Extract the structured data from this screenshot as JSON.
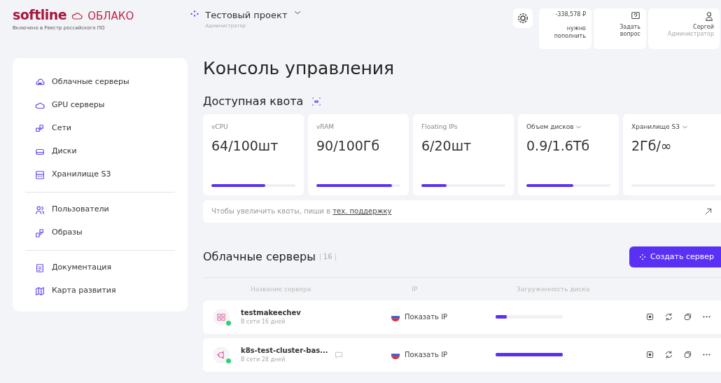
{
  "brand": {
    "name": "softline",
    "product": "ОБЛАКО",
    "tagline": "Включено в Реестр российского ПО"
  },
  "project": {
    "name": "Тестовый проект",
    "role": "Администратор"
  },
  "balance": {
    "amount": "-338,578 ₽",
    "note": "нужно пополнить"
  },
  "help": {
    "label": "Задать вопрос"
  },
  "user": {
    "name": "Сергей",
    "role": "Администратор"
  },
  "sidebar": {
    "groups": [
      {
        "items": [
          {
            "label": "Облачные серверы",
            "kind": "server"
          },
          {
            "label": "GPU серверы",
            "kind": "cloud"
          },
          {
            "label": "Сети",
            "kind": "network"
          },
          {
            "label": "Диски",
            "kind": "disk"
          },
          {
            "label": "Хранилище S3",
            "kind": "storage"
          }
        ]
      },
      {
        "items": [
          {
            "label": "Пользователи",
            "kind": "users"
          },
          {
            "label": "Образы",
            "kind": "images"
          }
        ]
      },
      {
        "items": [
          {
            "label": "Документация",
            "kind": "doc"
          },
          {
            "label": "Карта развития",
            "kind": "map"
          }
        ]
      }
    ]
  },
  "page_title": "Консоль управления",
  "quota": {
    "title": "Доступная квота",
    "visible": true,
    "cards": [
      {
        "label": "vCPU",
        "value": "64/100шт",
        "level": 0.64,
        "dropdown": false
      },
      {
        "label": "vRAM",
        "value": "90/100Гб",
        "level": 0.9,
        "dropdown": false
      },
      {
        "label": "Floating IPs",
        "value": "6/20шт",
        "level": 0.3,
        "dropdown": false
      },
      {
        "label": "Объем дисков",
        "value": "0.9/1.6Тб",
        "level": 0.56,
        "dropdown": true
      },
      {
        "label": "Хранилище S3",
        "value": "2Гб/∞",
        "level": 0,
        "dropdown": true
      }
    ],
    "hint": "Чтобы увеличить квоты, пиши в",
    "hint_link": "тех. поддержку"
  },
  "servers": {
    "title": "Облачные серверы",
    "count": "16",
    "create_button": "Создать сервер",
    "columns": [
      "Название сервера",
      "IP",
      "Загруженность диска"
    ],
    "rows": [
      {
        "name": "testmakeechev",
        "uptime": "В сети 16 дней",
        "kind": "windows",
        "online": true,
        "comment": false,
        "ip": "Показать IP",
        "level": 0.17
      },
      {
        "name": "k8s-test-cluster-bas...",
        "uptime": "В сети 28 дней",
        "kind": "ubuntu",
        "online": true,
        "comment": true,
        "ip": "Показать IP",
        "level": 1
      }
    ]
  }
}
